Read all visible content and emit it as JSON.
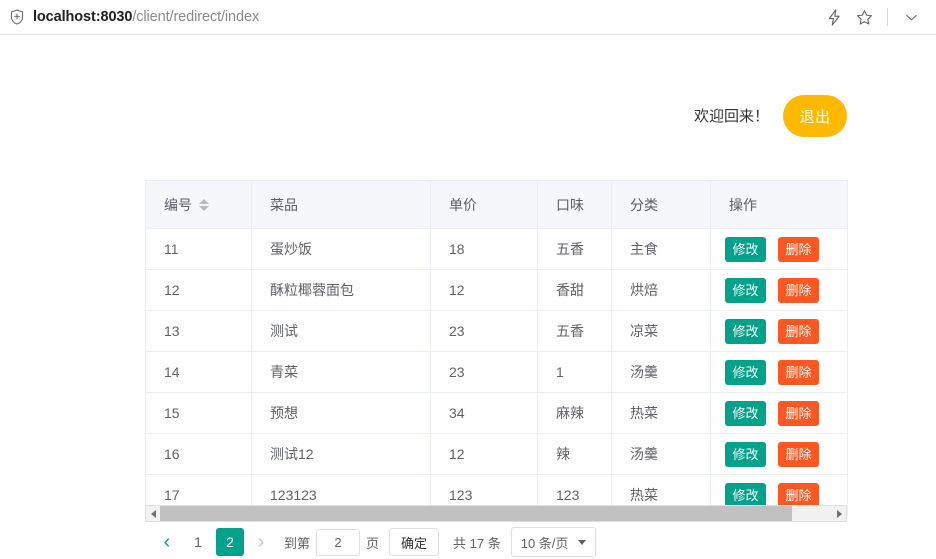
{
  "browser": {
    "url_host": "localhost:8030",
    "url_path": "/client/redirect/index",
    "icons": {
      "site_info": "shield-plus-icon",
      "immersive_reader": "lightning-icon",
      "bookmark": "star-icon",
      "overflow": "chevron-down-icon"
    }
  },
  "header": {
    "welcome_text": "欢迎回来！",
    "logout_label": "退出"
  },
  "table": {
    "columns": [
      {
        "key": "id",
        "label": "编号",
        "sortable": true
      },
      {
        "key": "name",
        "label": "菜品",
        "sortable": false
      },
      {
        "key": "price",
        "label": "单价",
        "sortable": false
      },
      {
        "key": "flavor",
        "label": "口味",
        "sortable": false
      },
      {
        "key": "category",
        "label": "分类",
        "sortable": false
      },
      {
        "key": "ops",
        "label": "操作",
        "sortable": false
      }
    ],
    "row_actions": {
      "edit_label": "修改",
      "delete_label": "删除",
      "edit_color": "#00A389",
      "delete_color": "#FF5722"
    },
    "rows": [
      {
        "id": "11",
        "name": "蛋炒饭",
        "price": "18",
        "flavor": "五香",
        "category": "主食"
      },
      {
        "id": "12",
        "name": "酥粒椰蓉面包",
        "price": "12",
        "flavor": "香甜",
        "category": "烘焙"
      },
      {
        "id": "13",
        "name": "测试",
        "price": "23",
        "flavor": "五香",
        "category": "凉菜"
      },
      {
        "id": "14",
        "name": "青菜",
        "price": "23",
        "flavor": "1",
        "category": "汤羹"
      },
      {
        "id": "15",
        "name": "预想",
        "price": "34",
        "flavor": "麻辣",
        "category": "热菜"
      },
      {
        "id": "16",
        "name": "测试12",
        "price": "12",
        "flavor": "辣",
        "category": "汤羹"
      },
      {
        "id": "17",
        "name": "123123",
        "price": "123",
        "flavor": "123",
        "category": "热菜"
      }
    ]
  },
  "pagination": {
    "prev_glyph": "‹",
    "next_glyph": "›",
    "pages": [
      "1",
      "2"
    ],
    "current_page": "2",
    "jump_prefix_label": "到第",
    "jump_value": "2",
    "jump_suffix_label": "页",
    "confirm_label": "确定",
    "total_label": "共 17 条",
    "page_size_label": "10 条/页",
    "accent_color": "#00A389"
  }
}
